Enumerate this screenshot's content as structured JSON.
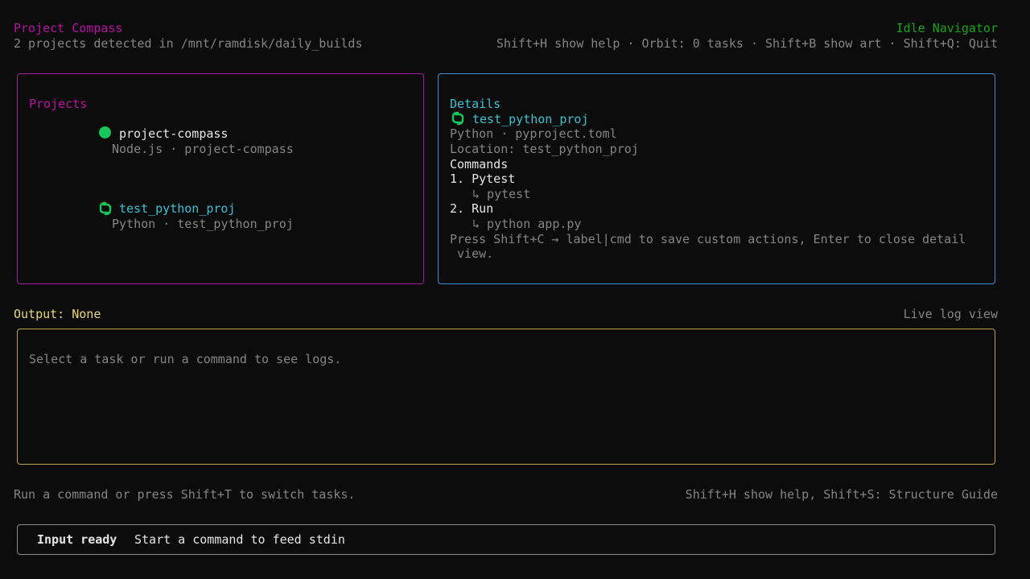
{
  "header": {
    "title": "Project Compass",
    "subtitle": "2 projects detected in /mnt/ramdisk/daily_builds",
    "mode": "Idle Navigator",
    "shortcuts": "Shift+H show help · Orbit: 0 tasks · Shift+B show art · Shift+Q: Quit"
  },
  "projects_panel": {
    "title": "Projects",
    "items": [
      {
        "name": "project-compass",
        "meta": "Node.js · project-compass",
        "icon": "green-circle-icon"
      },
      {
        "name": "test_python_proj",
        "meta": "Python · test_python_proj",
        "icon": "python-icon"
      }
    ]
  },
  "details_panel": {
    "title": "Details",
    "project_name": "test_python_proj",
    "meta": "Python · pyproject.toml",
    "location": "Location: test_python_proj",
    "commands_heading": "Commands",
    "commands": [
      {
        "label": "1. Pytest",
        "cmd": "↳ pytest"
      },
      {
        "label": "2. Run",
        "cmd": "↳ python app.py"
      }
    ],
    "hint_line1": "Press Shift+C → label|cmd to save custom actions, Enter to close detail",
    "hint_line2": " view."
  },
  "output": {
    "label": "Output:",
    "value": "None",
    "right_label": "Live log view",
    "placeholder": "Select a task or run a command to see logs."
  },
  "footer": {
    "left_hint": "Run a command or press Shift+T to switch tasks.",
    "right_hint": "Shift+H show help, Shift+S: Structure Guide"
  },
  "input_bar": {
    "status": "Input ready",
    "message": "Start a command to feed stdin"
  },
  "colors": {
    "background": "#0c0c0c",
    "accent_magenta": "#b4139e",
    "accent_blue": "#3a8fd0",
    "accent_yellow": "#c0a24a",
    "accent_green": "#15a317",
    "cyan": "#3ec1d0"
  }
}
